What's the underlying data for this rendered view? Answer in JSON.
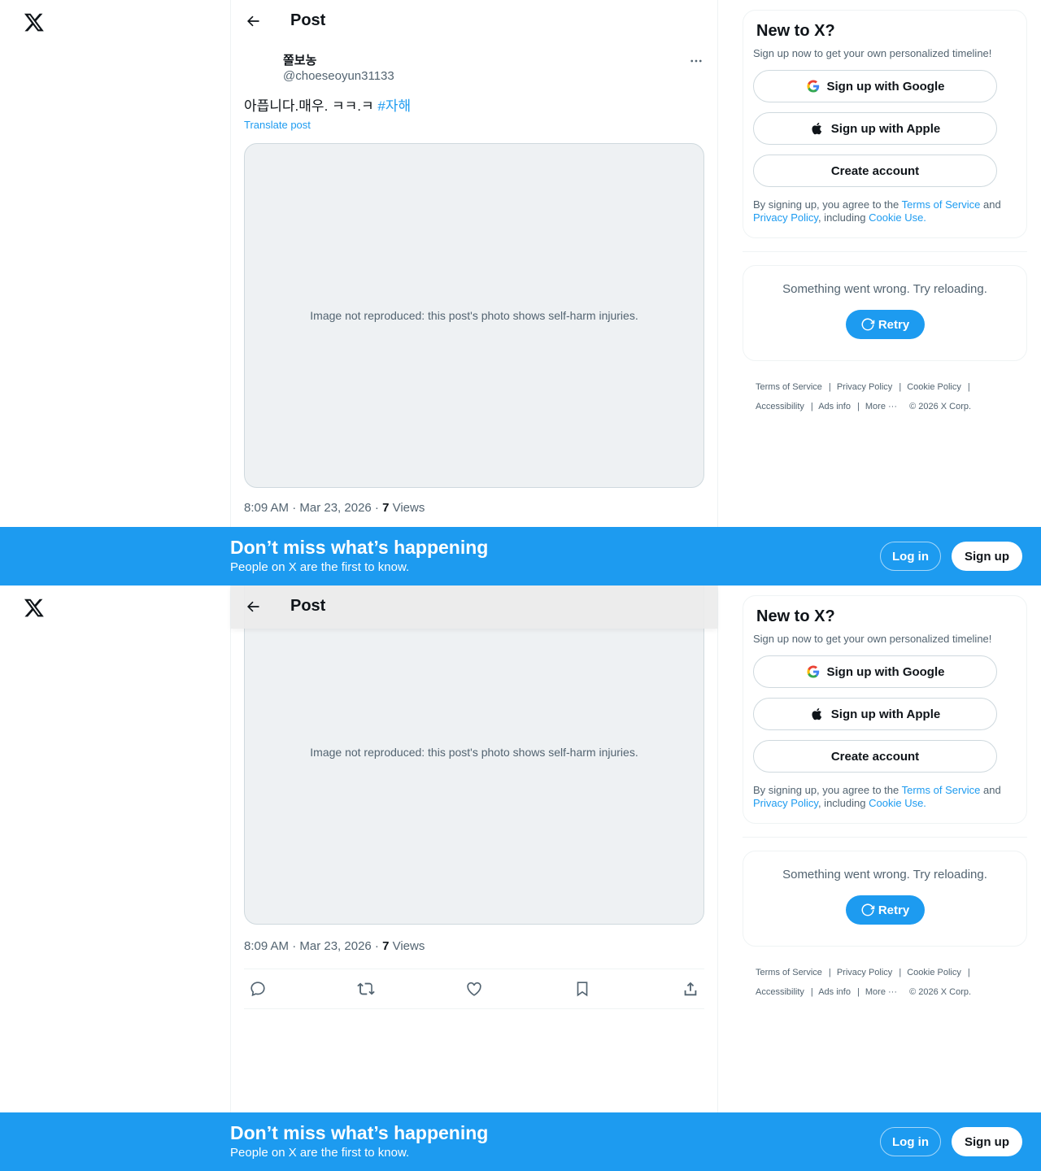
{
  "header": {
    "title": "Post"
  },
  "post": {
    "author_name": "쫄보농",
    "author_handle": "@choeseoyun31133",
    "text": "아픕니다.매우. ㅋㅋ.ㅋ",
    "hashtag": "#자해",
    "translate_label": "Translate post",
    "media_placeholder": "Image not reproduced: this post's photo shows self-harm injuries.",
    "timestamp": "8:09 AM · Mar 23, 2026 · ",
    "views_count": "7",
    "views_label": " Views"
  },
  "signup_card": {
    "title": "New to X?",
    "subtitle": "Sign up now to get your own personalized timeline!",
    "google_label": "Sign up with Google",
    "apple_label": "Sign up with Apple",
    "create_label": "Create account",
    "fine_prefix": "By signing up, you agree to the ",
    "terms": "Terms of Service",
    "and": " and ",
    "privacy": "Privacy Policy",
    "including": ", including ",
    "cookie": "Cookie Use."
  },
  "error_card": {
    "message": "Something went wrong. Try reloading.",
    "retry_label": "Retry"
  },
  "footer": {
    "terms": "Terms of Service",
    "privacy": "Privacy Policy",
    "cookie": "Cookie Policy",
    "accessibility": "Accessibility",
    "ads": "Ads info",
    "more": "More ···",
    "copyright": "© 2026 X Corp."
  },
  "banner": {
    "title": "Don’t miss what’s happening",
    "subtitle": "People on X are the first to know.",
    "login_label": "Log in",
    "signup_label": "Sign up"
  },
  "colors": {
    "accent": "#1d9bf0",
    "text": "#0f1419",
    "muted": "#536471",
    "border": "#eff3f4"
  }
}
